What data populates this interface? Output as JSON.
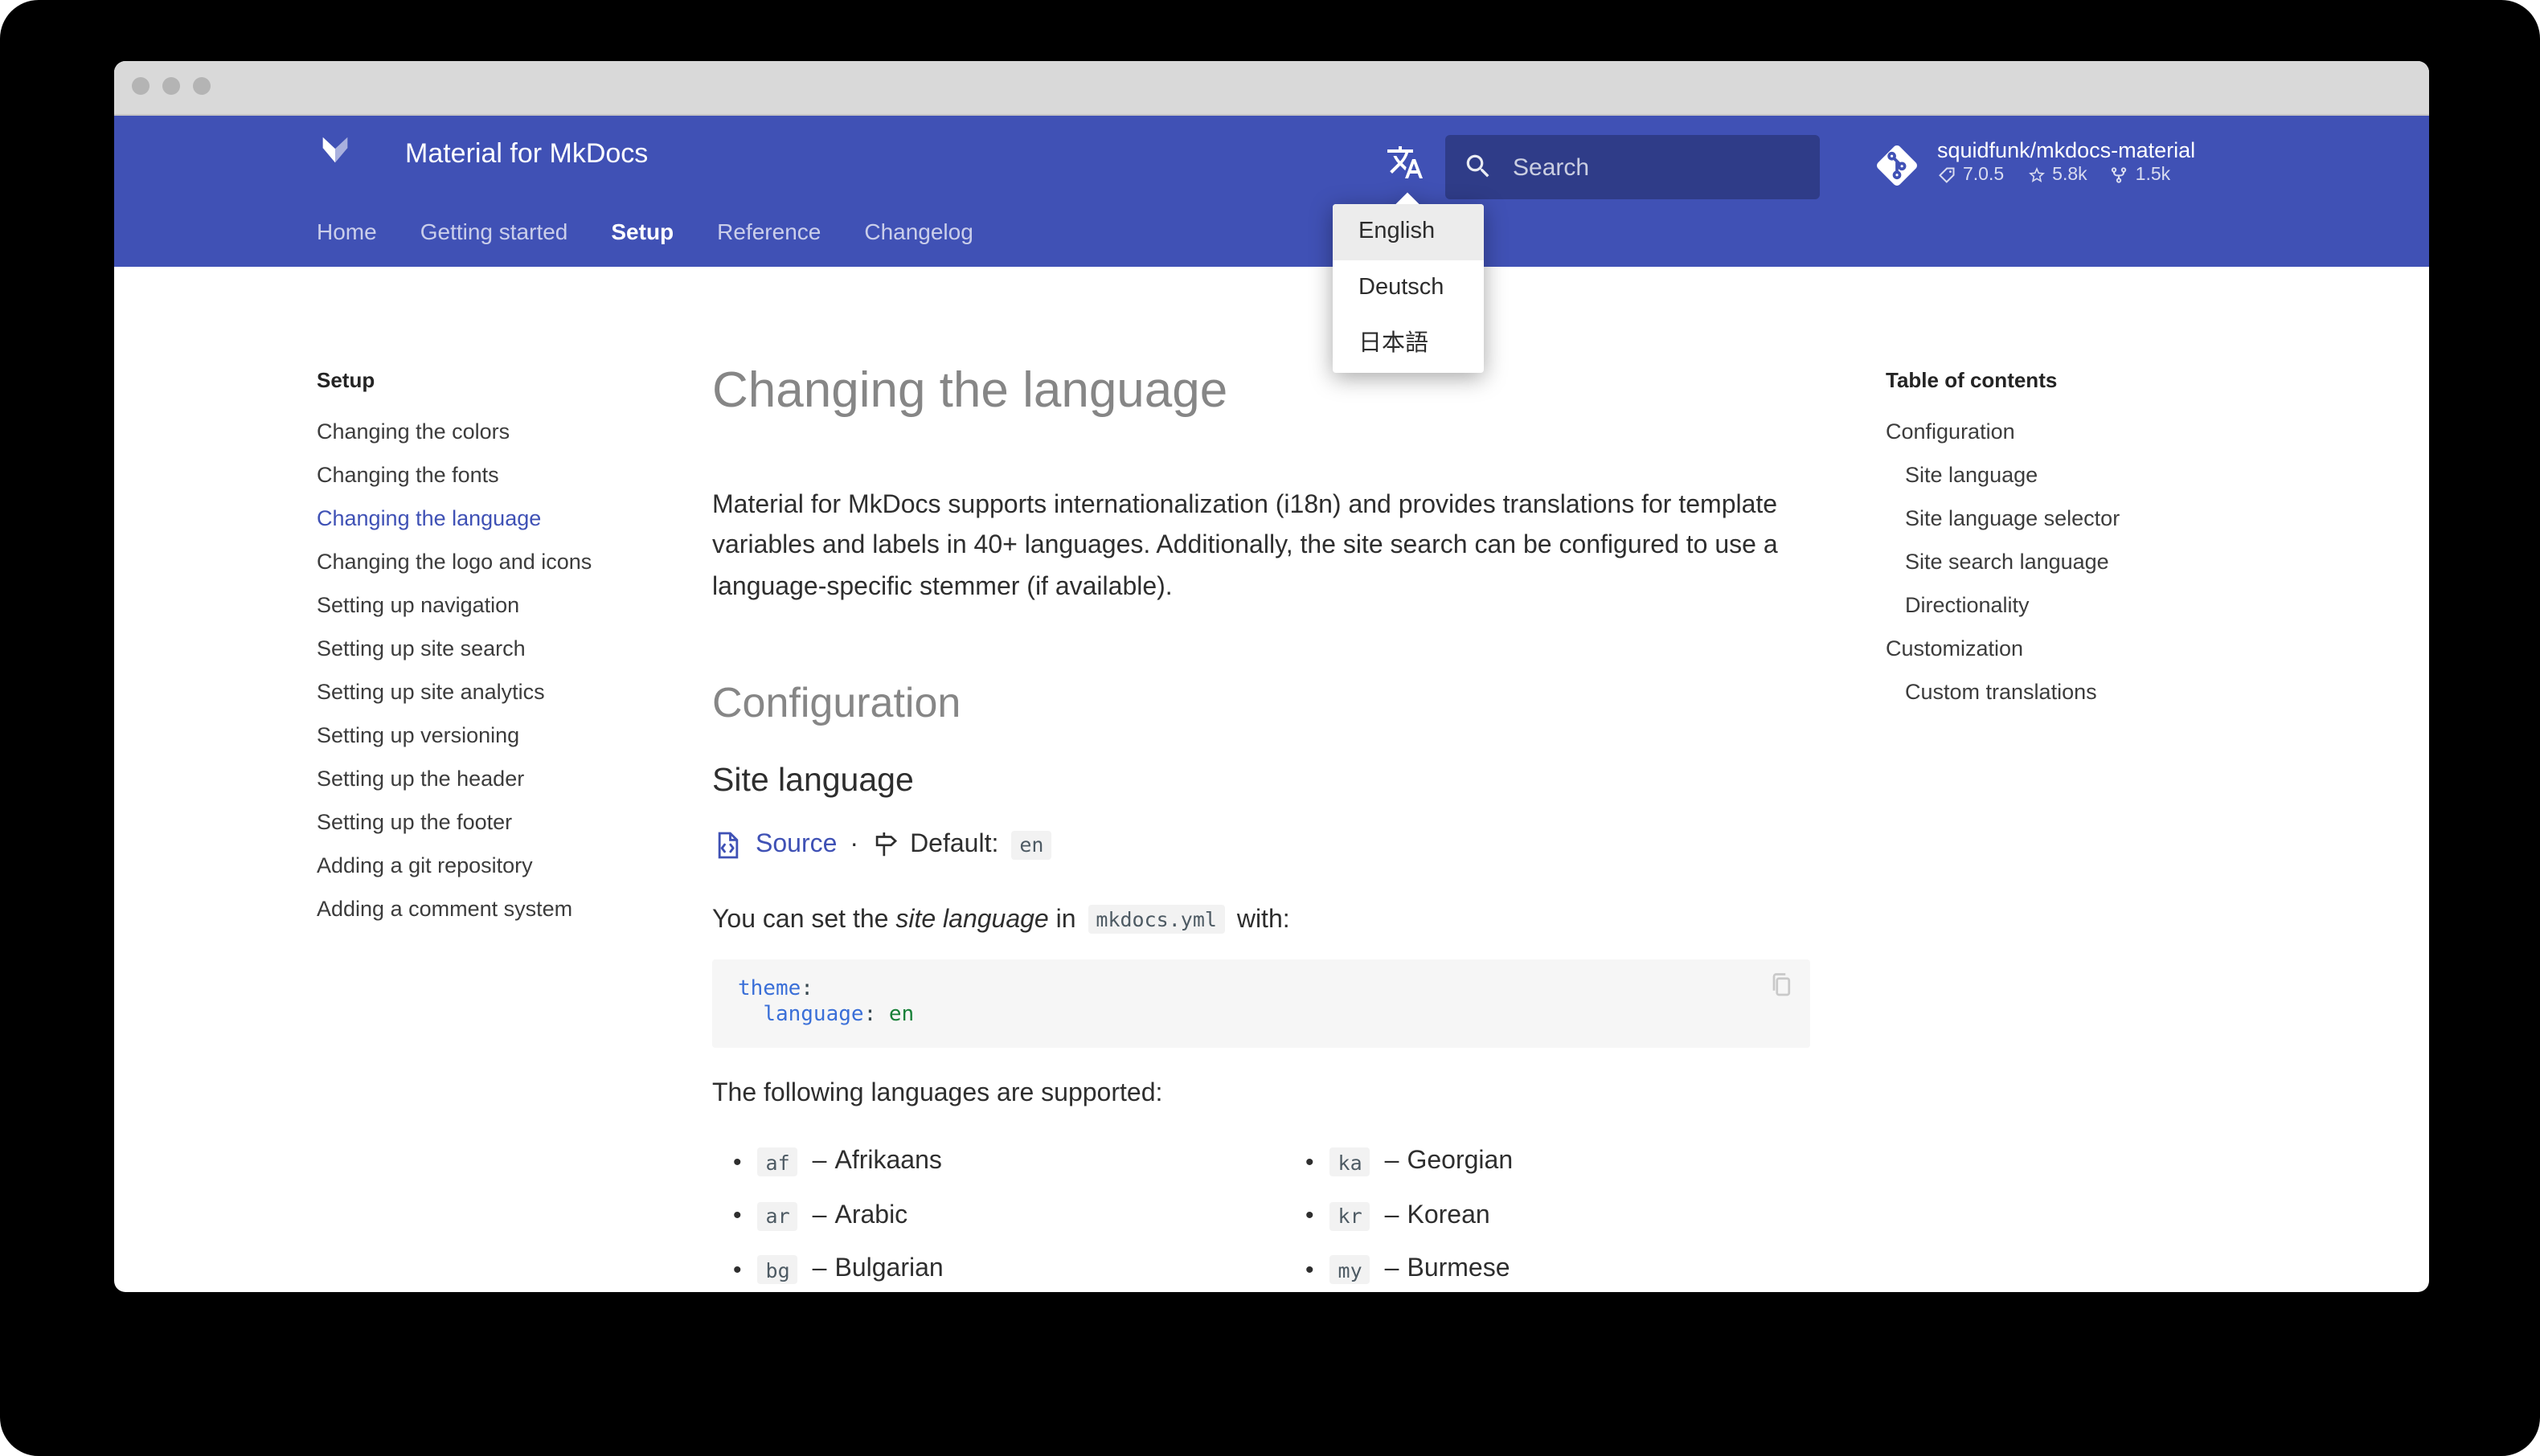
{
  "header": {
    "site_title": "Material for MkDocs",
    "tabs": [
      {
        "label": "Home"
      },
      {
        "label": "Getting started"
      },
      {
        "label": "Setup",
        "active": true
      },
      {
        "label": "Reference"
      },
      {
        "label": "Changelog"
      }
    ],
    "search": {
      "placeholder": "Search"
    },
    "repo": {
      "name": "squidfunk/mkdocs-material",
      "version": "7.0.5",
      "stars": "5.8k",
      "forks": "1.5k"
    }
  },
  "language_menu": {
    "items": [
      {
        "label": "English",
        "selected": true
      },
      {
        "label": "Deutsch"
      },
      {
        "label": "日本語"
      }
    ]
  },
  "sidebar": {
    "title": "Setup",
    "items": [
      {
        "label": "Changing the colors"
      },
      {
        "label": "Changing the fonts"
      },
      {
        "label": "Changing the language",
        "active": true
      },
      {
        "label": "Changing the logo and icons"
      },
      {
        "label": "Setting up navigation"
      },
      {
        "label": "Setting up site search"
      },
      {
        "label": "Setting up site analytics"
      },
      {
        "label": "Setting up versioning"
      },
      {
        "label": "Setting up the header"
      },
      {
        "label": "Setting up the footer"
      },
      {
        "label": "Adding a git repository"
      },
      {
        "label": "Adding a comment system"
      }
    ]
  },
  "toc": {
    "title": "Table of contents",
    "items": [
      {
        "label": "Configuration",
        "level": 1
      },
      {
        "label": "Site language",
        "level": 2
      },
      {
        "label": "Site language selector",
        "level": 2
      },
      {
        "label": "Site search language",
        "level": 2
      },
      {
        "label": "Directionality",
        "level": 2
      },
      {
        "label": "Customization",
        "level": 1
      },
      {
        "label": "Custom translations",
        "level": 2
      }
    ]
  },
  "article": {
    "title": "Changing the language",
    "intro": "Material for MkDocs supports internationalization (i18n) and provides translations for template variables and labels in 40+ languages. Additionally, the site search can be configured to use a language-specific stemmer (if available).",
    "section_title": "Configuration",
    "subsection_title": "Site language",
    "source_label": "Source",
    "meta_separator": "·",
    "default_label": "Default:",
    "default_value": "en",
    "body_pre": "You can set the ",
    "body_em": "site language",
    "body_mid": " in ",
    "body_code": "mkdocs.yml",
    "body_post": " with:",
    "code_block": {
      "line1_key": "theme",
      "line1_colon": ":",
      "line2_indent": "  ",
      "line2_key": "language",
      "line2_colon": ": ",
      "line2_value": "en"
    },
    "supported": "The following languages are supported:",
    "dash": "–",
    "languages_left": [
      {
        "code": "af",
        "name": "Afrikaans"
      },
      {
        "code": "ar",
        "name": "Arabic"
      },
      {
        "code": "bg",
        "name": "Bulgarian"
      }
    ],
    "languages_right": [
      {
        "code": "ka",
        "name": "Georgian"
      },
      {
        "code": "kr",
        "name": "Korean"
      },
      {
        "code": "my",
        "name": "Burmese"
      }
    ]
  },
  "colors": {
    "header_bg": "#4051b5",
    "search_bg": "#2f3c88",
    "accent_link": "#3f51b5",
    "code_key": "#3a6fd8",
    "code_value": "#188038",
    "menu_selected_bg": "#ececec",
    "muted_heading": "#868686"
  }
}
